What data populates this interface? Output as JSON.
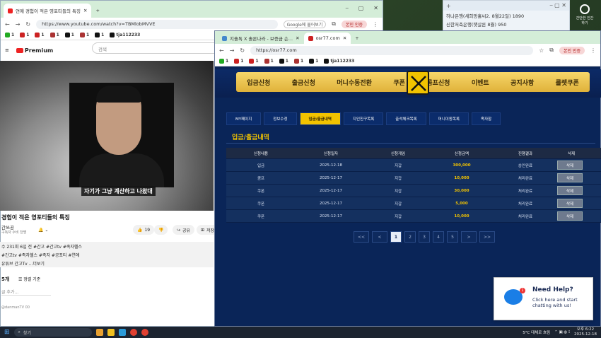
{
  "notepad": {
    "lines": [
      "하나은행(새희망홀씨2. 8월22일) 1890",
      "신한저축은행(햇살론 8월) 950"
    ],
    "desk_icon_label": "간단한 인간 \n하기"
  },
  "left_browser": {
    "tab_title": "연애 경험이 적은 영포티들의 특징",
    "url": "https://www.youtube.com/watch?v=TBMlobMVVE",
    "google_btn": "Google에 물어보기",
    "profile_btn": "본인 인증",
    "bookmarks": [
      "1",
      "1",
      "1",
      "1",
      "1",
      "1",
      "1",
      "tja112233"
    ],
    "yt_logo": "Premium",
    "search_placeholder": "검색",
    "caption": "자기가 그냥 계산하고 나왔대",
    "video_title": "경험이 적은 영포티들의 특징",
    "channel": "간쓰공",
    "subscribers": "구독자 수비 천명",
    "likes": "19",
    "share": "공유",
    "save": "저장",
    "desc_line1": "수 231회 6일 전 #간고 #간고tv #족자헬스",
    "desc_line2": "#간고tv #족자헬스 #족자 #공포티 #연애",
    "desc_line3": "유튜브 간고Tv ...더보기",
    "comments_count": "5개",
    "sort_label": "정렬 기준",
    "comment_placeholder": "글 추가...",
    "bottom_text": "@danmanTV 00"
  },
  "right_browser": {
    "tab1_title": "지솔톡 X 솔론나라 - 보증금 손...",
    "tab2_title": "osr77.com",
    "url": "https://osr77.com",
    "profile_btn": "본인 인증",
    "bookmarks": [
      "1",
      "1",
      "1",
      "1",
      "1",
      "1",
      "1",
      "tja112233"
    ],
    "nav": [
      "입금신청",
      "출금신청",
      "머니수동전환",
      "쿠폰",
      "콤프신청",
      "이벤트",
      "공지사항",
      "룰렛쿠폰"
    ],
    "subnav": [
      "MY페이지",
      "정보수정",
      "입금/출금내역",
      "지인친구목록",
      "출석체크목록",
      "머니이동목록",
      "족자함"
    ],
    "section_title": "입금/출금내역",
    "table": {
      "headers": [
        "신청내용",
        "신청일자",
        "신청게임",
        "신청금액",
        "진행결과",
        "삭제"
      ],
      "rows": [
        [
          "입금",
          "2025-12-18",
          "지갑",
          "300,000",
          "승인완료",
          "삭제"
        ],
        [
          "콤프",
          "2025-12-17",
          "지갑",
          "10,000",
          "처리완료",
          "삭제"
        ],
        [
          "쿠폰",
          "2025-12-17",
          "지갑",
          "30,000",
          "처리완료",
          "삭제"
        ],
        [
          "쿠폰",
          "2025-12-17",
          "지갑",
          "5,000",
          "처리완료",
          "삭제"
        ],
        [
          "쿠폰",
          "2025-12-17",
          "지갑",
          "10,000",
          "처리완료",
          "삭제"
        ]
      ]
    },
    "pager": [
      "<<",
      "<",
      "1",
      "2",
      "3",
      "4",
      "5",
      ">",
      ">>"
    ],
    "help": {
      "title": "Need Help?",
      "text": "Click here and start chatting with us!",
      "badge": "1"
    }
  },
  "taskbar": {
    "search": "찾기",
    "weather": "5°C 대체로 흐림",
    "time": "오후 6:22",
    "date": "2025-12-18"
  }
}
